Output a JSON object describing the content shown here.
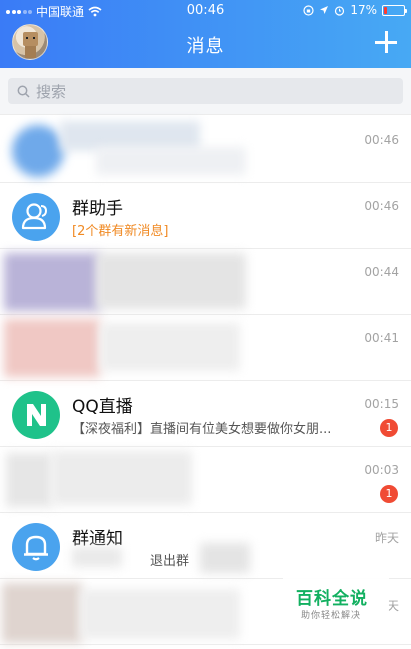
{
  "status_bar": {
    "carrier": "中国联通",
    "time": "00:46",
    "battery": "17%",
    "battery_color": "#ff3b30"
  },
  "header": {
    "title": "消息",
    "avatar_icon": "user-avatar",
    "add_icon": "plus-icon",
    "gradient": [
      "#3a7bf6",
      "#47a9f4"
    ]
  },
  "search": {
    "placeholder": "搜索",
    "icon": "search-icon"
  },
  "conversations": [
    {
      "name": "",
      "preview": "",
      "time": "00:46",
      "badge": "",
      "blurred": true
    },
    {
      "name": "群助手",
      "preview": "[2个群有新消息]",
      "preview_color": "#f08a24",
      "time": "00:46",
      "badge": "",
      "icon": "group-helper-icon"
    },
    {
      "name": "",
      "preview": "",
      "time": "00:44",
      "badge": "",
      "blurred": true
    },
    {
      "name": "",
      "preview": "",
      "time": "00:41",
      "badge": "",
      "blurred": true
    },
    {
      "name": "QQ直播",
      "preview": "【深夜福利】直播间有位美女想要做你女朋...",
      "time": "00:15",
      "badge": "1",
      "icon": "qq-live-icon"
    },
    {
      "name": "",
      "preview": "",
      "time": "00:03",
      "badge": "1",
      "blurred": true
    },
    {
      "name": "群通知",
      "preview": "退出群",
      "time": "昨天",
      "badge": "",
      "icon": "bell-icon"
    },
    {
      "name": "",
      "preview": "",
      "time": "天",
      "badge": "",
      "blurred": true
    }
  ],
  "watermark": {
    "title": "百科全说",
    "subtitle": "助你轻松解决"
  }
}
